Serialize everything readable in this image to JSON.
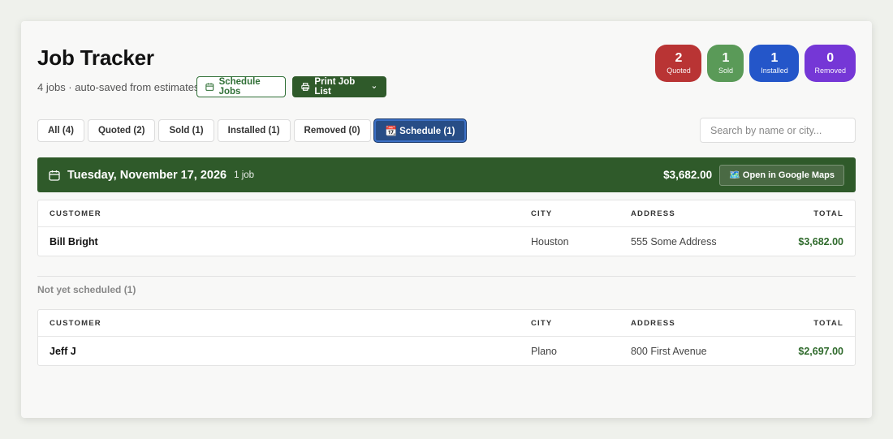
{
  "header": {
    "title": "Job Tracker",
    "subtitle": "4 jobs · auto-saved from estimates",
    "schedule_jobs_label": "Schedule Jobs",
    "print_job_list_label": "Print Job List"
  },
  "badges": [
    {
      "count": "2",
      "label": "Quoted",
      "color": "#b93434"
    },
    {
      "count": "1",
      "label": "Sold",
      "color": "#5a9a58"
    },
    {
      "count": "1",
      "label": "Installed",
      "color": "#2456c9"
    },
    {
      "count": "0",
      "label": "Removed",
      "color": "#7537d6"
    }
  ],
  "tabs": [
    {
      "label": "All (4)",
      "active": false
    },
    {
      "label": "Quoted (2)",
      "active": false
    },
    {
      "label": "Sold (1)",
      "active": false
    },
    {
      "label": "Installed (1)",
      "active": false
    },
    {
      "label": "Removed (0)",
      "active": false
    },
    {
      "label": "📆 Schedule (1)",
      "active": true
    }
  ],
  "search": {
    "placeholder": "Search by name or city...",
    "value": ""
  },
  "table_headers": {
    "customer": "CUSTOMER",
    "city": "CITY",
    "address": "ADDRESS",
    "total": "TOTAL"
  },
  "scheduled_group": {
    "date": "Tuesday, November 17, 2026",
    "job_count": "1 job",
    "total": "$3,682.00",
    "maps_label": "🗺️ Open in Google Maps",
    "rows": [
      {
        "customer": "Bill Bright",
        "city": "Houston",
        "address": "555 Some Address",
        "total": "$3,682.00"
      }
    ]
  },
  "unscheduled_group": {
    "label": "Not yet scheduled (1)",
    "rows": [
      {
        "customer": "Jeff J",
        "city": "Plano",
        "address": "800 First Avenue",
        "total": "$2,697.00"
      }
    ]
  },
  "colors": {
    "primary_green": "#2f5a2a",
    "active_tab_blue": "#274d86",
    "money_green": "#2f6a2c"
  }
}
